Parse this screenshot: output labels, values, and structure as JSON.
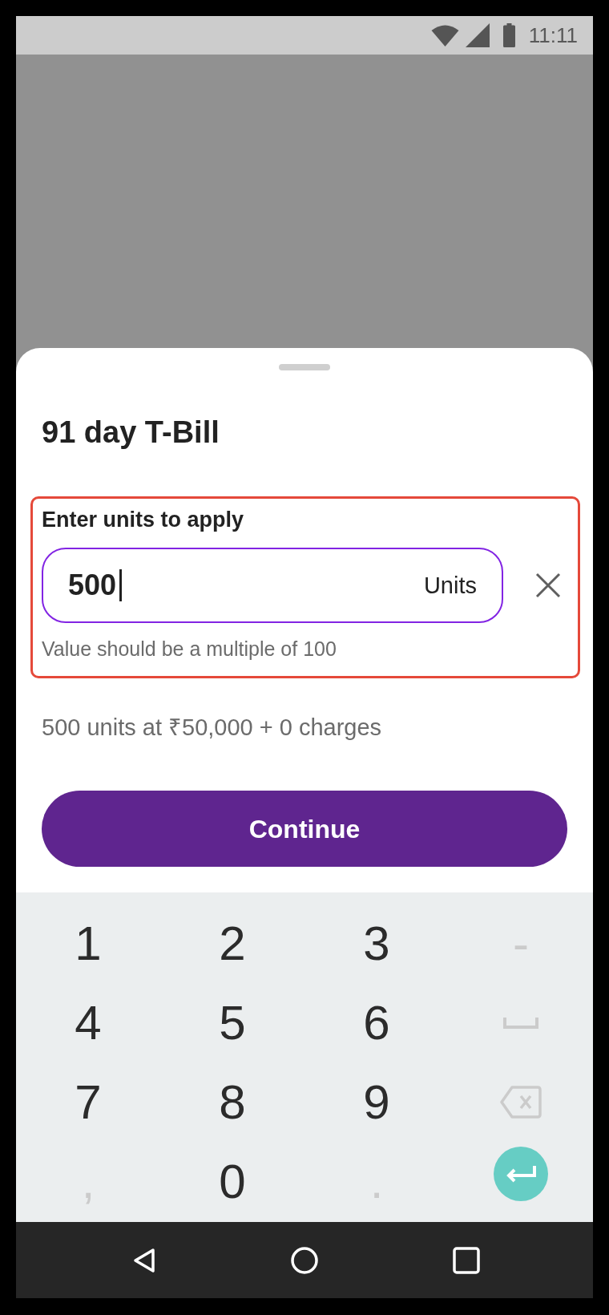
{
  "status_bar": {
    "time": "11:11"
  },
  "sheet": {
    "title": "91 day T-Bill",
    "field": {
      "label": "Enter units to apply",
      "value": "500",
      "suffix": "Units",
      "helper_text": "Value should be a multiple of 100",
      "focused": true,
      "highlighted": true
    },
    "summary": "500 units at ₹50,000 + 0 charges",
    "button": "Continue"
  },
  "keyboard": {
    "keys": [
      {
        "kind": "char",
        "label": "1",
        "disabled": false
      },
      {
        "kind": "char",
        "label": "2",
        "disabled": false
      },
      {
        "kind": "char",
        "label": "3",
        "disabled": false
      },
      {
        "kind": "char",
        "label": "-",
        "disabled": true
      },
      {
        "kind": "char",
        "label": "4",
        "disabled": false
      },
      {
        "kind": "char",
        "label": "5",
        "disabled": false
      },
      {
        "kind": "char",
        "label": "6",
        "disabled": false
      },
      {
        "kind": "space",
        "disabled": true
      },
      {
        "kind": "char",
        "label": "7",
        "disabled": false
      },
      {
        "kind": "char",
        "label": "8",
        "disabled": false
      },
      {
        "kind": "char",
        "label": "9",
        "disabled": false
      },
      {
        "kind": "backspace",
        "disabled": true
      },
      {
        "kind": "char",
        "label": ",",
        "disabled": true
      },
      {
        "kind": "char",
        "label": "0",
        "disabled": false
      },
      {
        "kind": "char",
        "label": ".",
        "disabled": true
      },
      {
        "kind": "enter",
        "disabled": false
      }
    ]
  }
}
